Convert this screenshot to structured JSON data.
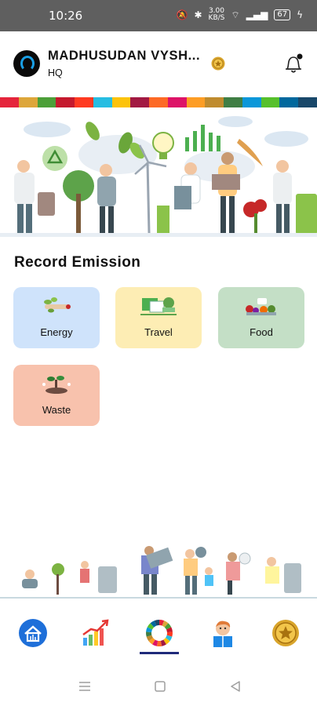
{
  "status_bar": {
    "time": "10:26",
    "network_speed": "3.00",
    "network_unit": "KB/S",
    "battery": "67"
  },
  "header": {
    "user_name": "MADHUSUDAN VYSH...",
    "user_subtitle": "HQ",
    "icons": [
      "profile-avatar-icon",
      "medal-icon",
      "notification-bell-icon"
    ],
    "notification_dot_color": "#111111"
  },
  "sdg_colors": [
    "#e5243b",
    "#dda63a",
    "#4c9f38",
    "#c5192d",
    "#ff3a21",
    "#26bde2",
    "#fcc30b",
    "#a21942",
    "#fd6925",
    "#dd1367",
    "#fd9d24",
    "#bf8b2e",
    "#3f7e44",
    "#0a97d9",
    "#56c02b",
    "#00689d",
    "#19486a"
  ],
  "section": {
    "title": "Record Emission"
  },
  "categories": [
    {
      "label": "Energy",
      "color": "#cfe3fb",
      "icon": "energy-icon"
    },
    {
      "label": "Travel",
      "color": "#fdedb4",
      "icon": "travel-icon"
    },
    {
      "label": "Food",
      "color": "#c4dfc6",
      "icon": "food-icon"
    },
    {
      "label": "Waste",
      "color": "#f8c2ad",
      "icon": "waste-icon"
    }
  ],
  "bottom_nav": {
    "items": [
      "home-icon",
      "growth-chart-icon",
      "sdg-wheel-icon",
      "reader-icon",
      "medal-icon"
    ],
    "active_index": 2,
    "active_color": "#1f2a7a"
  },
  "system_nav": [
    "menu-icon",
    "home-square-icon",
    "back-triangle-icon"
  ]
}
